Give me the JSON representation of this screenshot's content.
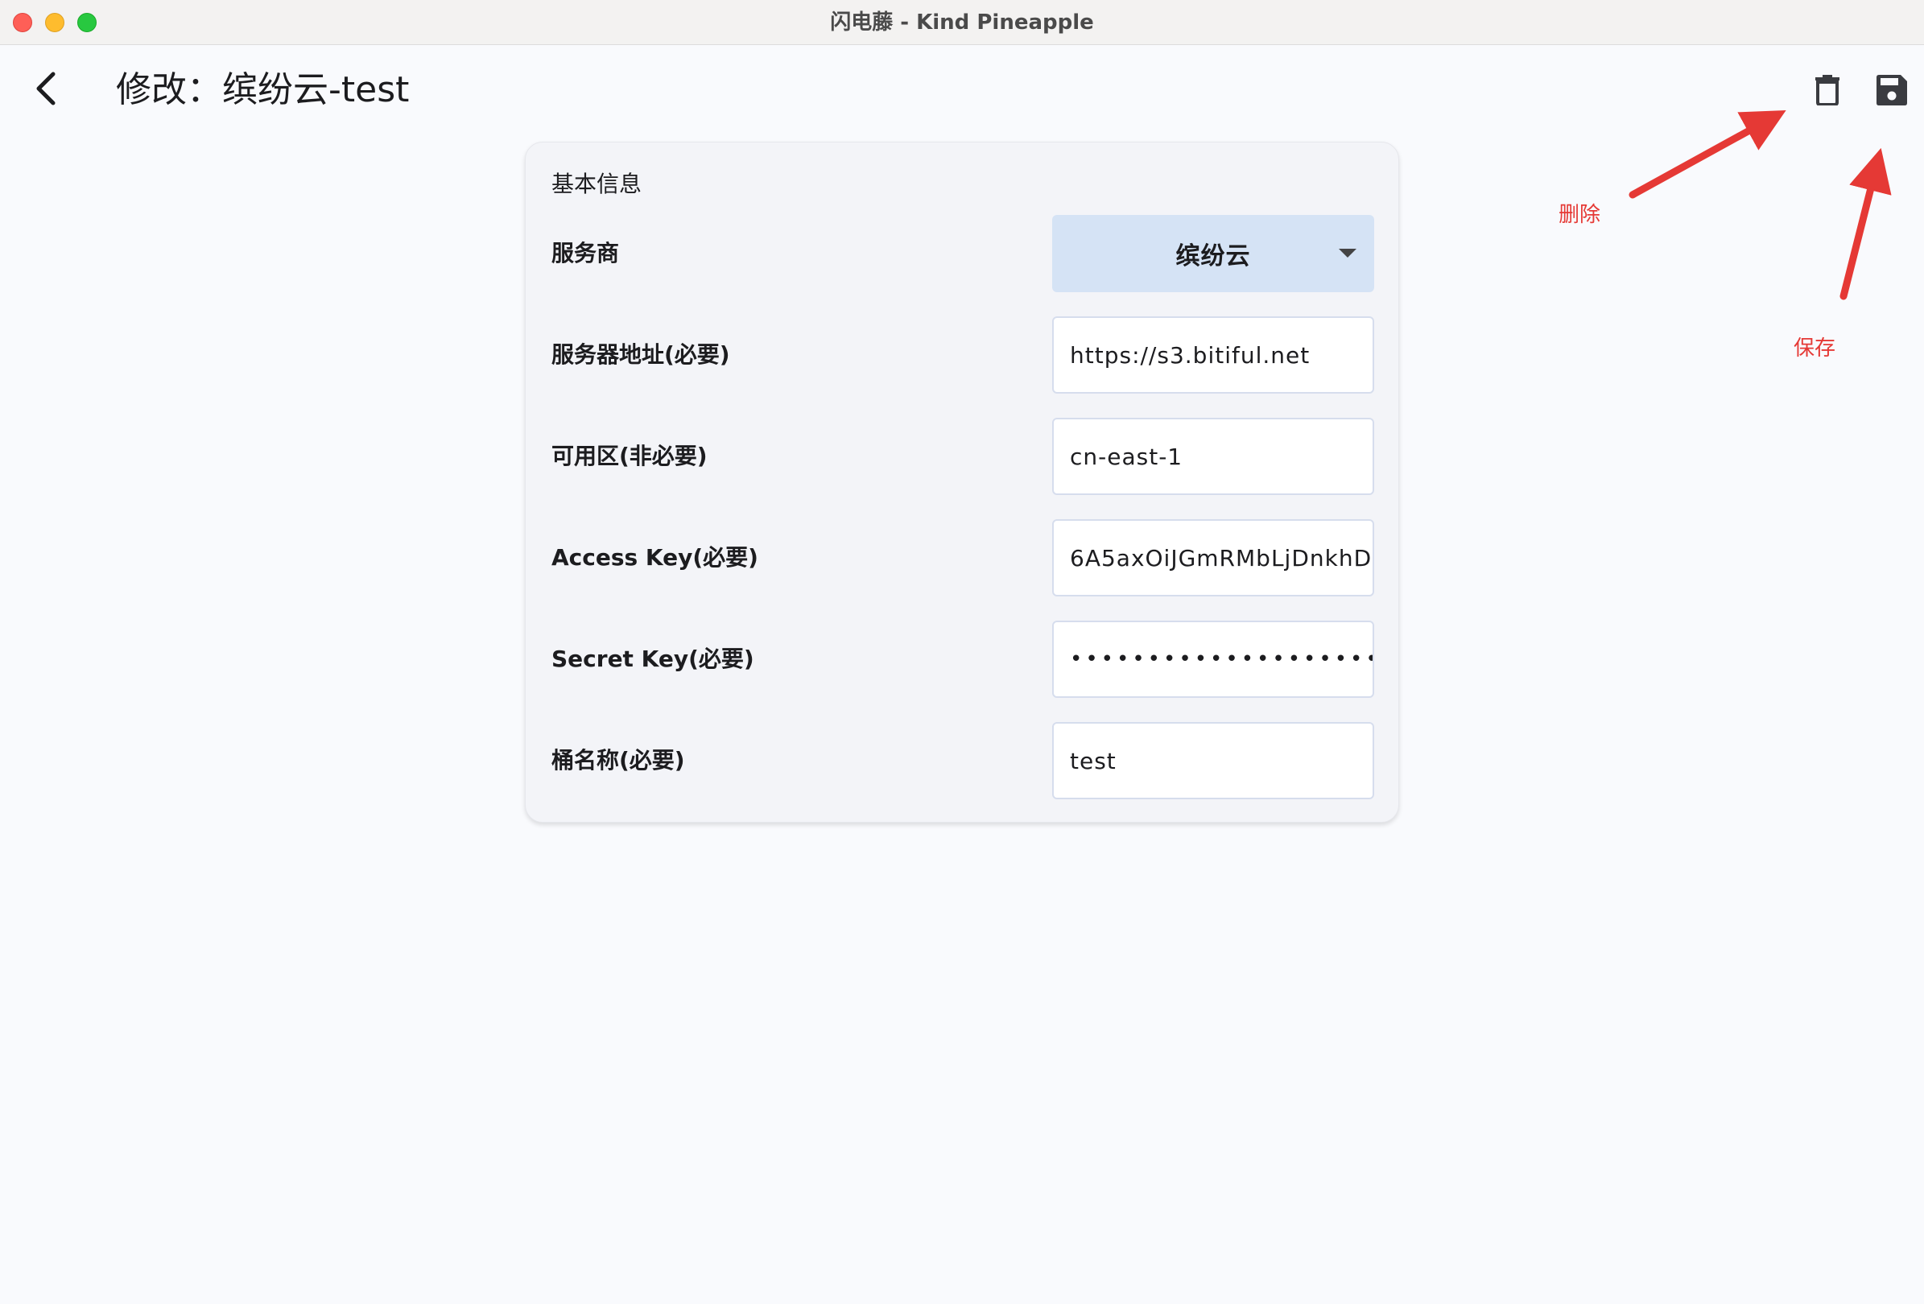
{
  "window": {
    "title": "闪电藤 - Kind Pineapple"
  },
  "appbar": {
    "title": "修改：缤纷云-test",
    "back_icon": "chevron-left-icon",
    "delete_icon": "trash-icon",
    "save_icon": "floppy-disk-icon"
  },
  "annotations": {
    "delete_label": "删除",
    "save_label": "保存",
    "color": "#e53935"
  },
  "form": {
    "section_title": "基本信息",
    "rows": [
      {
        "label": "服务商",
        "value": "缤纷云"
      },
      {
        "label": "服务器地址(必要)",
        "value": "https://s3.bitiful.net"
      },
      {
        "label": "可用区(非必要)",
        "value": "cn-east-1"
      },
      {
        "label": "Access Key(必要)",
        "value": "6A5axOiJGmRMbLjDnkhD"
      },
      {
        "label": "Secret Key(必要)",
        "value": "••••••••••••••••••••••••••"
      },
      {
        "label": "桶名称(必要)",
        "value": "test"
      }
    ]
  },
  "colors": {
    "dropdown_bg": "#d5e3f5",
    "page_bg": "#f9fafd",
    "card_bg": "#f3f4f8"
  }
}
